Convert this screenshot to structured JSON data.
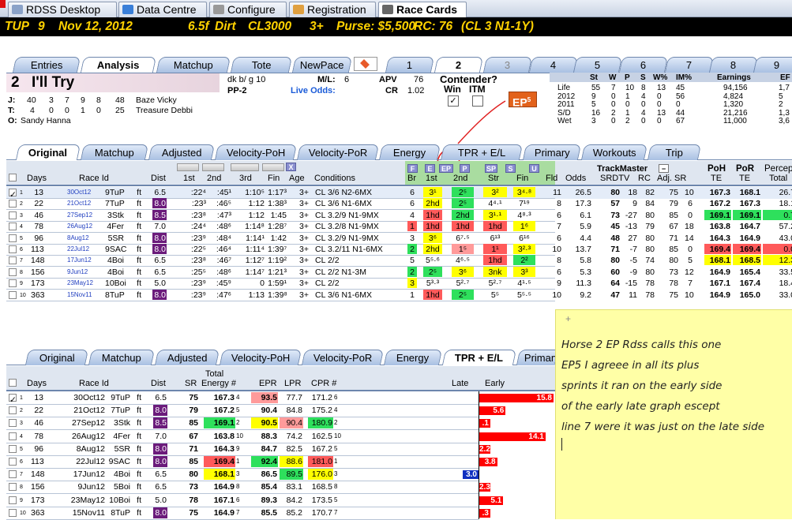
{
  "app_tabs": [
    {
      "label": "RDSS Desktop",
      "color": "#8aa2c8"
    },
    {
      "label": "Data Centre",
      "color": "#3a7fd8"
    },
    {
      "label": "Configure",
      "color": "#999999"
    },
    {
      "label": "Registration",
      "color": "#e0a040"
    },
    {
      "label": "Race Cards",
      "color": "#666666"
    }
  ],
  "race": {
    "track": "TUP",
    "race_no": "9",
    "date": "Nov 12, 2012",
    "distance": "6.5f",
    "surface": "Dirt",
    "class": "CL3000",
    "age": "3+",
    "purse": "Purse: $5,500",
    "rc": "RC: 76",
    "cond": "(CL 3 N1-1Y)"
  },
  "top_tabs": [
    "Entries",
    "Analysis",
    "Matchup",
    "Tote",
    "NewPace"
  ],
  "num_tabs": [
    "1",
    "2",
    "3",
    "4",
    "5",
    "6",
    "7",
    "8",
    "9"
  ],
  "horse": {
    "number": "2",
    "name": "I'll Try",
    "desc": "dk b/ g 10",
    "pp": "PP-2",
    "ml_label": "M/L:",
    "ml": "6",
    "live_odds": "Live Odds:",
    "apv_label": "APV",
    "apv": "76",
    "cr_label": "CR",
    "cr": "1.02",
    "jockey_label": "J:",
    "jockey_stats": [
      "40",
      "3",
      "7",
      "9",
      "8",
      "48"
    ],
    "jockey": "Baze Vicky",
    "trainer_label": "T:",
    "trainer_stats": [
      "4",
      "0",
      "0",
      "1",
      "0",
      "25"
    ],
    "trainer": "Treasure Debbi",
    "owner_label": "O:",
    "owner": "Sandy Hanna"
  },
  "contender": {
    "title": "Contender?",
    "win": "Win",
    "itm": "ITM",
    "ep": "EP",
    "ep_val": "5"
  },
  "stats": {
    "headers": [
      "St",
      "W",
      "P",
      "S",
      "W%",
      "IM%",
      "Earnings",
      "EF"
    ],
    "rows": [
      [
        "Life",
        "55",
        "7",
        "10",
        "8",
        "13",
        "45",
        "94,156",
        "1,7"
      ],
      [
        "2012",
        "9",
        "0",
        "1",
        "4",
        "0",
        "56",
        "4,824",
        "5"
      ],
      [
        "2011",
        "5",
        "0",
        "0",
        "0",
        "0",
        "0",
        "1,320",
        "2"
      ],
      [
        "S/D",
        "16",
        "2",
        "1",
        "4",
        "13",
        "44",
        "21,216",
        "1,3"
      ],
      [
        "Wet",
        "3",
        "0",
        "2",
        "0",
        "0",
        "67",
        "11,000",
        "3,6"
      ]
    ]
  },
  "grid_tabs": [
    "Original",
    "Matchup",
    "Adjusted",
    "Velocity-PoH",
    "Velocity-PoR",
    "Energy",
    "TPR + E/L",
    "Primary",
    "Workouts",
    "Trip"
  ],
  "grid1": {
    "headers": {
      "days": "Days",
      "raceid": "Race Id",
      "dist": "Dist",
      "q1": "1st",
      "q2": "2nd",
      "q3": "3rd",
      "fin": "Fin",
      "age": "Age",
      "cond": "Conditions",
      "br": "Br",
      "c1": "1st",
      "c2": "2nd",
      "str": "Str",
      "cfin": "Fin",
      "fld": "Fld",
      "odds": "Odds",
      "tm": "TrackMaster",
      "srdtv": "SRDTV",
      "rc": "RC",
      "adjsr": "Adj. SR",
      "poh": "PoH",
      "poh2": "TE",
      "por": "PoR",
      "por2": "TE",
      "perc": "Percep",
      "perc2": "Total"
    },
    "btns": [
      "F",
      "E",
      "EP",
      "P",
      "SP",
      "S",
      "U"
    ],
    "rows": [
      [
        "1",
        "13",
        "",
        "30Oct12",
        "9TuP",
        "ft",
        "6.5",
        ":22⁴",
        ":45¹",
        "1:10⁵",
        "1:17³",
        "3+",
        "CL 3/6 N2-6MX",
        "6",
        "3¹",
        "2⁵",
        "3²",
        "3⁴·⁸",
        "11",
        "26.5",
        "80",
        "18",
        "82",
        "75",
        "10",
        "167.3",
        "168.1",
        "26.7"
      ],
      [
        "2",
        "22",
        "",
        "21Oct12",
        "7TuP",
        "ft",
        "8.0",
        ":23³",
        ":46⁵",
        "1:12",
        "1:38³",
        "3+",
        "CL 3/6 N1-6MX",
        "6",
        "2hd",
        "2⁵",
        "4⁴·¹",
        "7¹⁹",
        "8",
        "17.3",
        "57",
        "9",
        "84",
        "79",
        "6",
        "167.2",
        "167.3",
        "18.1"
      ],
      [
        "3",
        "46",
        "32",
        "27Sep12",
        "3Stk",
        "ft",
        "8.5",
        ":23⁸",
        ":47³",
        "1:12",
        "1:45",
        "3+",
        "CL 3.2/9 N1-9MX",
        "4",
        "1hd",
        "2hd",
        "3¹·¹",
        "4⁸·³",
        "6",
        "6.1",
        "73",
        "-27",
        "80",
        "85",
        "0",
        "169.1",
        "169.1",
        "0.7"
      ],
      [
        "4",
        "78",
        "",
        "26Aug12",
        "4Fer",
        "ft",
        "7.0",
        ":24⁴",
        ":48⁶",
        "1:14⁸",
        "1:28⁷",
        "3+",
        "CL 3.2/8 N1-9MX",
        "1",
        "1hd",
        "1hd",
        "1hd",
        "1⁶",
        "7",
        "5.9",
        "45",
        "-13",
        "79",
        "67",
        "18",
        "163.8",
        "164.7",
        "57.2"
      ],
      [
        "5",
        "96",
        "",
        "8Aug12",
        "5SR",
        "ft",
        "8.0",
        ":23⁹",
        ":48⁴",
        "1:14¹",
        "1:42",
        "3+",
        "CL 3.2/9 N1-9MX",
        "3",
        "3⁶",
        "6⁷·⁵",
        "6¹³",
        "6¹⁶",
        "6",
        "4.4",
        "48",
        "27",
        "80",
        "71",
        "14",
        "164.3",
        "164.9",
        "43.0"
      ],
      [
        "6",
        "113",
        "35",
        "22Jul12",
        "9SAC",
        "ft",
        "8.0",
        ":22⁵",
        ":46⁴",
        "1:11⁴",
        "1:39⁷",
        "3+",
        "CL 3.2/11 N1-6MX",
        "2",
        "2hd",
        "1⁵",
        "1¹",
        "3²·³",
        "10",
        "13.7",
        "71",
        "-7",
        "80",
        "85",
        "0",
        "169.4",
        "169.4",
        "0.0"
      ],
      [
        "7",
        "148",
        "",
        "17Jun12",
        "4Boi",
        "ft",
        "6.5",
        ":23⁸",
        ":46⁷",
        "1:12⁷",
        "1:19²",
        "3+",
        "CL 2/2",
        "5",
        "5⁵·⁶",
        "4⁶·⁵",
        "1hd",
        "2²",
        "8",
        "5.8",
        "80",
        "-5",
        "74",
        "80",
        "5",
        "168.1",
        "168.5",
        "12.3"
      ],
      [
        "8",
        "156",
        "",
        "9Jun12",
        "4Boi",
        "ft",
        "6.5",
        ":25⁵",
        ":48⁶",
        "1:14⁷",
        "1:21³",
        "3+",
        "CL 2/2 N1-3M",
        "2",
        "2⁵",
        "3⁶",
        "3nk",
        "3³",
        "6",
        "5.3",
        "60",
        "-9",
        "80",
        "73",
        "12",
        "164.9",
        "165.4",
        "33.5"
      ],
      [
        "9",
        "173",
        "190",
        "23May12",
        "10Boi",
        "ft",
        "5.0",
        ":23⁹",
        ":45⁹",
        "0",
        "1:59¹",
        "3+",
        "CL 2/2",
        "3",
        "5³·³",
        "5²·⁷",
        "5²·⁷",
        "4¹·⁵",
        "9",
        "11.3",
        "64",
        "-15",
        "78",
        "78",
        "7",
        "167.1",
        "167.4",
        "18.4"
      ],
      [
        "10",
        "363",
        "",
        "15Nov11",
        "8TuP",
        "ft",
        "8.0",
        ":23⁹",
        ":47⁶",
        "1:13",
        "1:39⁸",
        "3+",
        "CL 3/6 N1-6MX",
        "1",
        "1hd",
        "2⁵",
        "5⁵",
        "5⁵·⁵",
        "10",
        "9.2",
        "47",
        "11",
        "78",
        "75",
        "10",
        "164.9",
        "165.0",
        "33.0"
      ]
    ]
  },
  "grid2": {
    "headers": {
      "days": "Days",
      "raceid": "Race Id",
      "dist": "Dist",
      "sr": "SR",
      "total": "Total",
      "energy": "Energy #",
      "epr": "EPR",
      "lpr": "LPR",
      "cpr": "CPR #",
      "late": "Late",
      "early": "Early"
    },
    "rows": [
      [
        "1",
        "13",
        "30Oct12",
        "9TuP",
        "ft",
        "6.5",
        "75",
        "167.3",
        "4",
        "93.5",
        "77.7",
        "171.2",
        "6"
      ],
      [
        "2",
        "22",
        "21Oct12",
        "7TuP",
        "ft",
        "8.0",
        "79",
        "167.2",
        "5",
        "90.4",
        "84.8",
        "175.2",
        "4"
      ],
      [
        "3",
        "46",
        "27Sep12",
        "3Stk",
        "ft",
        "8.5",
        "85",
        "169.1",
        "2",
        "90.5",
        "90.4",
        "180.9",
        "2"
      ],
      [
        "4",
        "78",
        "26Aug12",
        "4Fer",
        "ft",
        "7.0",
        "67",
        "163.8",
        "10",
        "88.3",
        "74.2",
        "162.5",
        "10"
      ],
      [
        "5",
        "96",
        "8Aug12",
        "5SR",
        "ft",
        "8.0",
        "71",
        "164.3",
        "9",
        "84.7",
        "82.5",
        "167.2",
        "5"
      ],
      [
        "6",
        "113",
        "22Jul12",
        "9SAC",
        "ft",
        "8.0",
        "85",
        "169.4",
        "1",
        "92.4",
        "88.6",
        "181.0",
        "1"
      ],
      [
        "7",
        "148",
        "17Jun12",
        "4Boi",
        "ft",
        "6.5",
        "80",
        "168.1",
        "3",
        "86.5",
        "89.5",
        "176.0",
        "3"
      ],
      [
        "8",
        "156",
        "9Jun12",
        "5Boi",
        "ft",
        "6.5",
        "73",
        "164.9",
        "8",
        "85.4",
        "83.1",
        "168.5",
        "8"
      ],
      [
        "9",
        "173",
        "23May12",
        "10Boi",
        "ft",
        "5.0",
        "78",
        "167.1",
        "6",
        "89.3",
        "84.2",
        "173.5",
        "5"
      ],
      [
        "10",
        "363",
        "15Nov11",
        "8TuP",
        "ft",
        "8.0",
        "75",
        "164.9",
        "7",
        "85.5",
        "85.2",
        "170.7",
        "7"
      ]
    ],
    "early_vals": [
      "15.8",
      "5.6",
      ".1",
      "14.1",
      "2.2",
      "3.8",
      "",
      "2.3",
      "5.1",
      ".3"
    ],
    "late_vals": [
      "",
      "",
      "",
      "",
      "",
      "",
      "3.0",
      "",
      "",
      ""
    ]
  },
  "note": {
    "plus": "+",
    "lines": [
      "Horse 2 EP  Rdss calls this one",
      "EP5 I agreee in all its plus",
      "sprints it ran on the early side",
      "of the early late graph escept",
      "line 7 were it was just on the late side"
    ]
  }
}
